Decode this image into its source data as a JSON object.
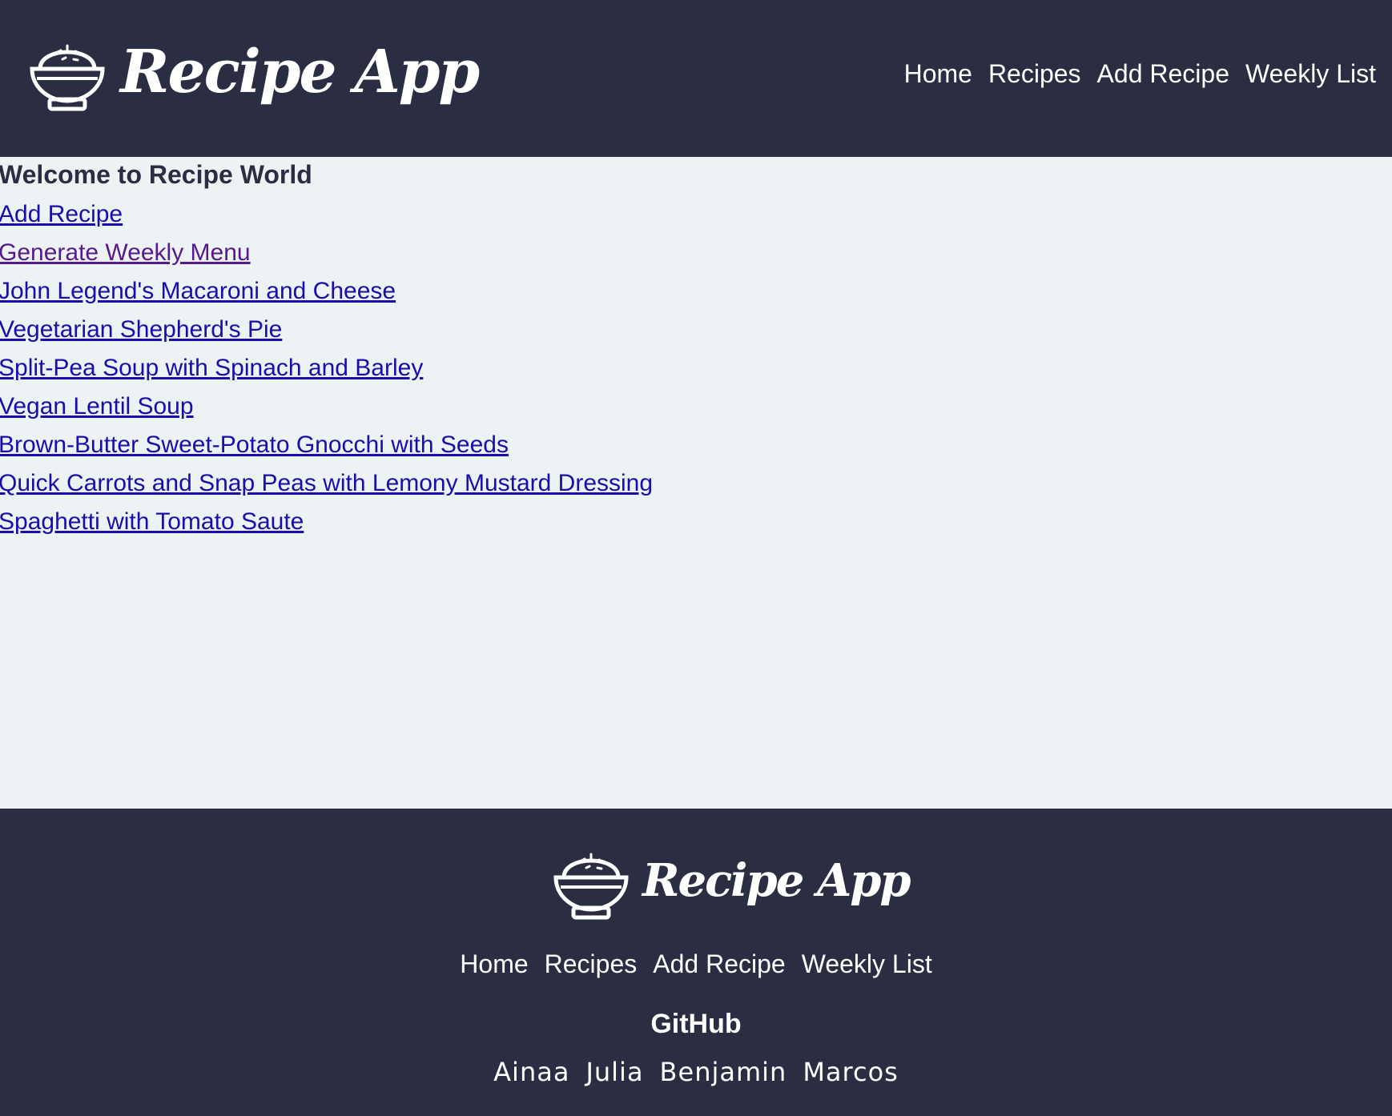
{
  "header": {
    "logo_icon": "rice-bowl-icon",
    "brand": "Recipe App",
    "nav": [
      "Home",
      "Recipes",
      "Add Recipe",
      "Weekly List"
    ]
  },
  "main": {
    "title": "Welcome to Recipe World",
    "links": [
      "Add Recipe",
      "Generate Weekly Menu",
      "John Legend's Macaroni and Cheese",
      "Vegetarian Shepherd's Pie",
      "Split-Pea Soup with Spinach and Barley",
      "Vegan Lentil Soup",
      "Brown-Butter Sweet-Potato Gnocchi with Seeds",
      "Quick Carrots and Snap Peas with Lemony Mustard Dressing",
      "Spaghetti with Tomato Saute"
    ]
  },
  "footer": {
    "logo_icon": "rice-bowl-icon",
    "brand": "Recipe App",
    "nav": [
      "Home",
      "Recipes",
      "Add Recipe",
      "Weekly List"
    ],
    "github_title": "GitHub",
    "github_links": [
      "Ainaa",
      "Julia",
      "Benjamin",
      "Marcos"
    ]
  },
  "colors": {
    "dark": "#2b2d42",
    "background": "#edf2f4",
    "link": "#1a0dab",
    "visited_link": "#551a8b"
  }
}
